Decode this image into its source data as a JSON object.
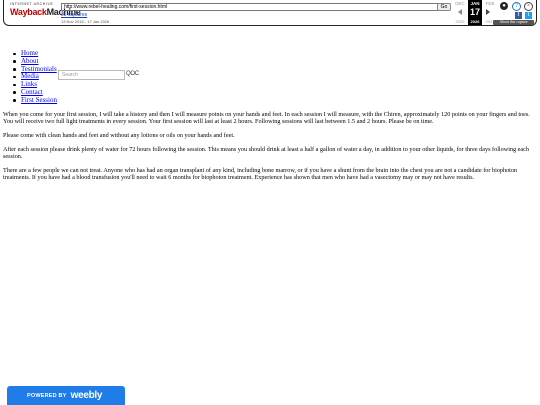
{
  "wayback": {
    "logo_small": "INTERNET ARCHIVE",
    "logo_way": "Wayback",
    "logo_machine": "Machine",
    "url": "http://www.rebel-healing.com/first-session.html",
    "go_label": "Go",
    "captures_label": "35 captures",
    "date_range": "13 Nov 2016 - 17 Jan 2026",
    "months": [
      "DEC",
      "JAN",
      "FEB"
    ],
    "day": "17",
    "years": [
      "2025",
      "2026",
      "2027"
    ],
    "about_label": "About this capture"
  },
  "nav": {
    "items": [
      "Home",
      "About",
      "Testimonials",
      "Media",
      "Links",
      "Contact",
      "First Session"
    ]
  },
  "search": {
    "placeholder": "Search",
    "icons_text": "QOC"
  },
  "content": {
    "paragraphs": [
      "When you come for your first session, I will take a history and then I will measure points on your hands and feet.  In each session I will measure, with the Chiren, approximately 120 points on your fingers and toes.  You will receive two full light treatments in every session.  Your first session will last at least 2 hours.  Following sessions will last between 1.5 and 2 hours.  Please be on time.",
      "Please come with clean hands and feet and without any lotions or oils on your hands and feet.",
      "After each session please drink plenty of water for 72 hours following the session.  This means you should drink at least a half a gallon of water a day, in addition to your other liquids, for three days following each session.",
      "There are a few people we can not treat.  Anyone who has had an organ transplant of any kind, including bone marrow, or if you have a shunt from the brain into the chest you are not a candidate for biophoton treatments.  If you have had a blood transfusion you'll need to wait 6 months for biophoton treatment. Experience has shown that men who have had a vasectomy may or may not have results."
    ]
  },
  "footer": {
    "powered_by": "POWERED BY",
    "brand": "weebly"
  }
}
